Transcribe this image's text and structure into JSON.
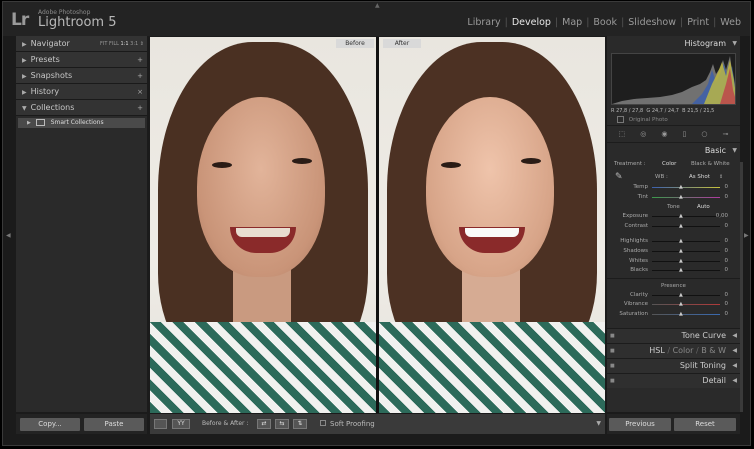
{
  "app": {
    "logo": "Lr",
    "brand_small": "Adobe Photoshop",
    "brand_name": "Lightroom 5"
  },
  "modules": [
    "Library",
    "Develop",
    "Map",
    "Book",
    "Slideshow",
    "Print",
    "Web"
  ],
  "active_module": "Develop",
  "left_panel": {
    "navigator": {
      "label": "Navigator",
      "options": [
        "FIT",
        "FILL",
        "1:1",
        "3:1"
      ],
      "selected_option": "1:1"
    },
    "presets": {
      "label": "Presets",
      "action": "+"
    },
    "snapshots": {
      "label": "Snapshots",
      "action": "+"
    },
    "history": {
      "label": "History",
      "action": "×"
    },
    "collections": {
      "label": "Collections",
      "action": "+"
    },
    "smart_collections": "Smart Collections"
  },
  "buttons": {
    "copy": "Copy...",
    "paste": "Paste",
    "previous": "Previous",
    "reset": "Reset"
  },
  "view": {
    "before_label": "Before",
    "after_label": "After"
  },
  "toolbar": {
    "view_mode": "YY",
    "before_after_label": "Before & After :",
    "soft_proofing": "Soft Proofing"
  },
  "right_panel": {
    "histogram_title": "Histogram",
    "histogram_readout": {
      "r": "R  27,8 / 27,8",
      "g": "G  24,7 / 24,7",
      "b": "B  21,5 / 21,5"
    },
    "original_photo": "Original Photo",
    "basic_title": "Basic",
    "treatment_label": "Treatment :",
    "treatment_color": "Color",
    "treatment_bw": "Black & White",
    "wb_label": "WB :",
    "wb_value": "As Shot",
    "wb_sliders": [
      {
        "label": "Temp",
        "value": "0"
      },
      {
        "label": "Tint",
        "value": "0"
      }
    ],
    "tone_label": "Tone",
    "tone_auto": "Auto",
    "tone_sliders": [
      {
        "label": "Exposure",
        "value": "0,00"
      },
      {
        "label": "Contrast",
        "value": "0"
      }
    ],
    "tone_sliders2": [
      {
        "label": "Highlights",
        "value": "0"
      },
      {
        "label": "Shadows",
        "value": "0"
      },
      {
        "label": "Whites",
        "value": "0"
      },
      {
        "label": "Blacks",
        "value": "0"
      }
    ],
    "presence_label": "Presence",
    "presence_sliders": [
      {
        "label": "Clarity",
        "value": "0"
      },
      {
        "label": "Vibrance",
        "value": "0"
      },
      {
        "label": "Saturation",
        "value": "0"
      }
    ],
    "tone_curve": "Tone Curve",
    "hsl": "HSL",
    "hsl_color": "Color",
    "hsl_bw": "B & W",
    "split_toning": "Split Toning",
    "detail": "Detail"
  }
}
